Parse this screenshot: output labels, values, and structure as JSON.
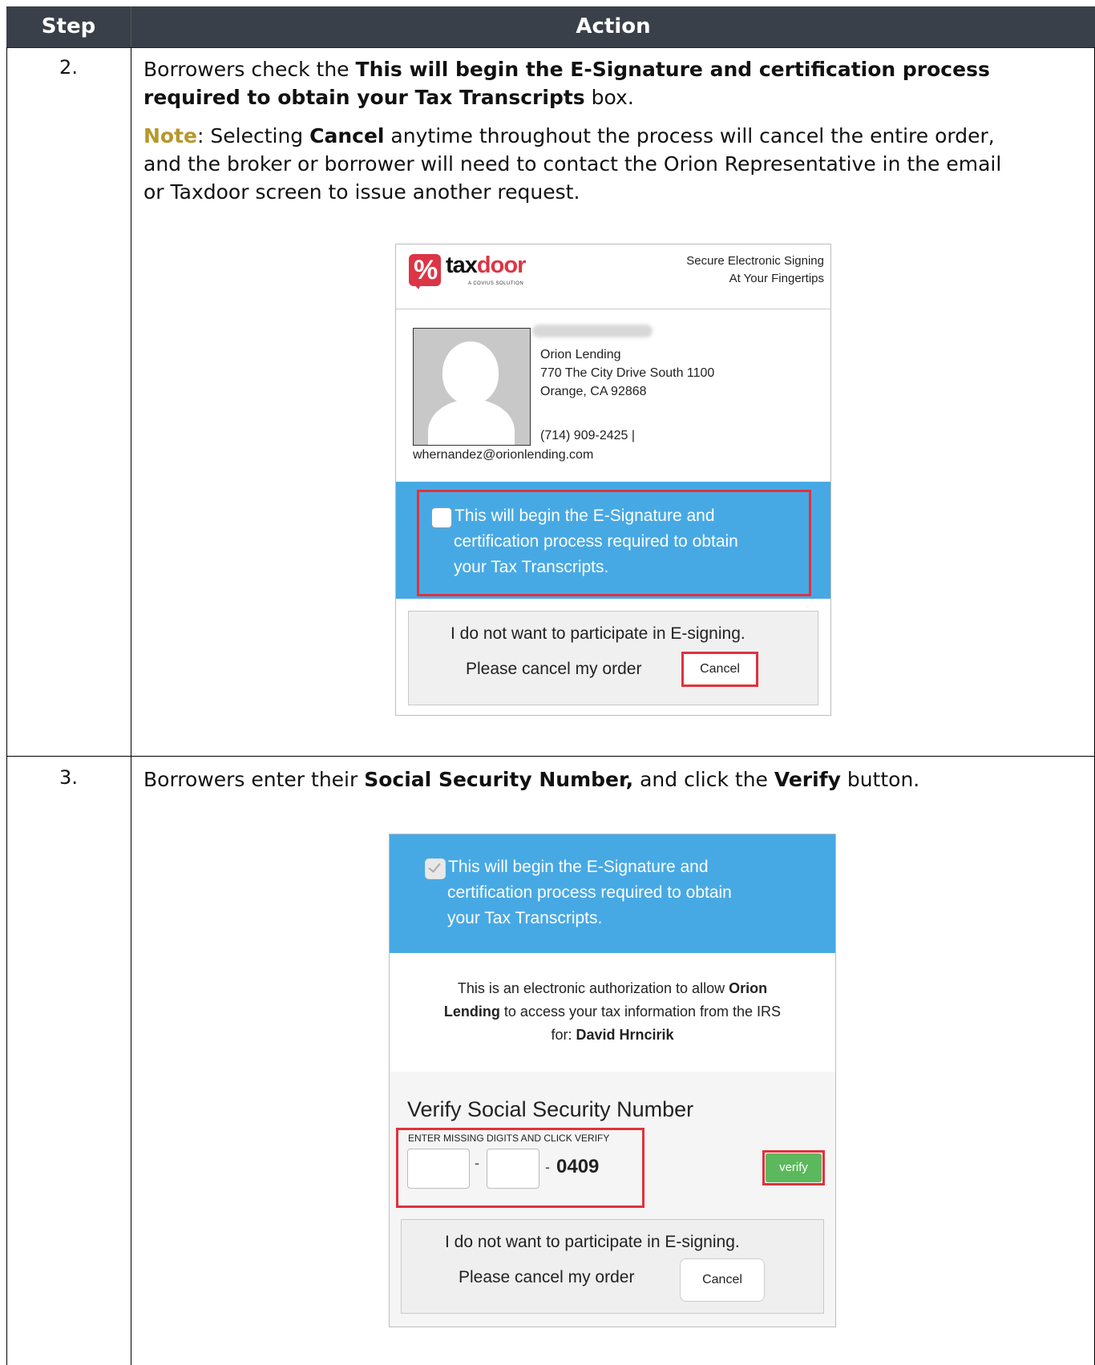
{
  "header": {
    "step": "Step",
    "action": "Action"
  },
  "rows": [
    {
      "step": "2.",
      "line1_prefix": "Borrowers check the ",
      "line1_bold": "This will begin the E-Signature and certification process",
      "line2_bold": "required to obtain your Tax Transcripts",
      "line2_suffix": " box.",
      "note_label": "Note",
      "note_text1": ": Selecting ",
      "note_bold": "Cancel",
      "note_text2": " anytime throughout the process will cancel the entire order,",
      "note_line2": "and the broker or borrower will need to contact the Orion Representative in the email",
      "note_line3": "or Taxdoor screen to issue another request."
    },
    {
      "step": "3.",
      "prefix": "Borrowers enter their ",
      "bold1": "Social Security Number,",
      "mid": " and click the ",
      "bold2": "Verify",
      "suffix": " button."
    }
  ],
  "shot1": {
    "logo_text_a": "tax",
    "logo_text_b": "door",
    "logo_sub": "A COVIUS SOLUTION",
    "tagline_1": "Secure Electronic Signing",
    "tagline_2": "At Your Fingertips",
    "company": "Orion Lending",
    "address1": "770 The City Drive South 1100",
    "address2": "Orange, CA 92868",
    "phone": "(714) 909-2425 |",
    "email": "whernandez@orionlending.com",
    "check_1": "This will begin the E-Signature and",
    "check_2": "certification process required to obtain",
    "check_3": "your Tax Transcripts.",
    "optout_1": "I do not want to participate in E-signing.",
    "optout_2": "Please cancel my order",
    "cancel": "Cancel"
  },
  "shot2": {
    "check_1": "This will begin the E-Signature and",
    "check_2": "certification process required to obtain",
    "check_3": "your Tax Transcripts.",
    "auth_1a": "This is an electronic authorization to allow ",
    "auth_1b": "Orion",
    "auth_2a": "Lending",
    "auth_2b": " to access your tax information from the IRS",
    "auth_3a": "for: ",
    "auth_3b": "David Hrncirik",
    "verify_title": "Verify Social Security Number",
    "verify_sub": "ENTER MISSING DIGITS AND CLICK VERIFY",
    "dash": "-",
    "ssn_last": "0409",
    "verify_btn": "verify",
    "optout_1": "I do not want to participate in E-signing.",
    "optout_2": "Please cancel my order",
    "cancel": "Cancel"
  }
}
